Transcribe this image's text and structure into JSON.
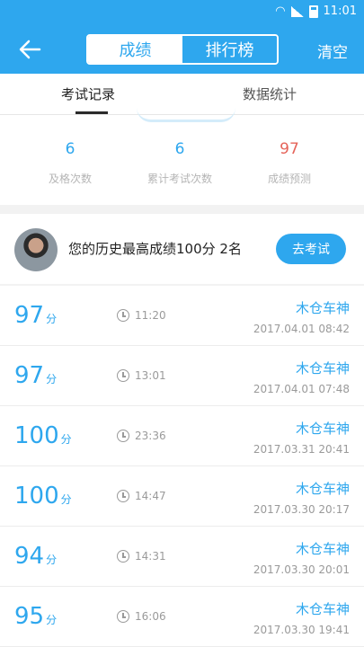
{
  "statusbar": {
    "time": "11:01"
  },
  "appbar": {
    "segment_active": "成绩",
    "segment_inactive": "排行榜",
    "clear_label": "清空"
  },
  "tabs": {
    "records": "考试记录",
    "stats": "数据统计"
  },
  "stats": [
    {
      "value": "6",
      "label": "及格次数"
    },
    {
      "value": "6",
      "label": "累计考试次数"
    },
    {
      "value": "97",
      "label": "成绩预测"
    }
  ],
  "best": {
    "text": "您的历史最高成绩100分 2名",
    "button": "去考试"
  },
  "records": [
    {
      "score": "97",
      "unit": "分",
      "time": "11:20",
      "car": "木仓车神",
      "datetime": "2017.04.01 08:42"
    },
    {
      "score": "97",
      "unit": "分",
      "time": "13:01",
      "car": "木仓车神",
      "datetime": "2017.04.01 07:48"
    },
    {
      "score": "100",
      "unit": "分",
      "time": "23:36",
      "car": "木仓车神",
      "datetime": "2017.03.31 20:41"
    },
    {
      "score": "100",
      "unit": "分",
      "time": "14:47",
      "car": "木仓车神",
      "datetime": "2017.03.30 20:17"
    },
    {
      "score": "94",
      "unit": "分",
      "time": "14:31",
      "car": "木仓车神",
      "datetime": "2017.03.30 20:01"
    },
    {
      "score": "95",
      "unit": "分",
      "time": "16:06",
      "car": "木仓车神",
      "datetime": "2017.03.30 19:41"
    }
  ],
  "colors": {
    "primary": "#2ea7ee",
    "prediction": "#e5645a"
  }
}
